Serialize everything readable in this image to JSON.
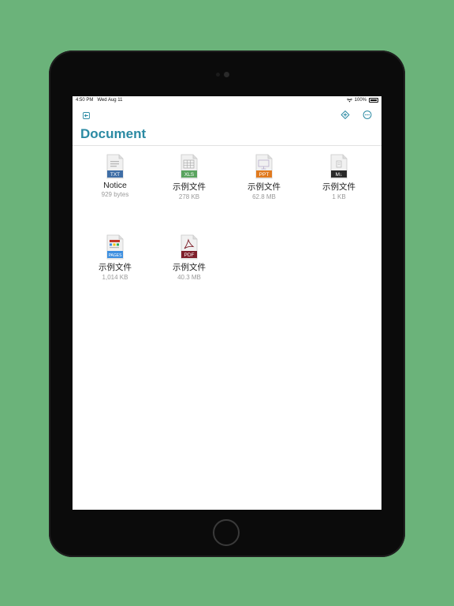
{
  "status_bar": {
    "time": "4:50 PM",
    "date": "Wed Aug 11",
    "battery": "100%"
  },
  "header": {
    "title": "Document"
  },
  "files": [
    {
      "name": "Notice",
      "size": "929 bytes",
      "badge": "TXT",
      "badge_color": "#3f6ea6"
    },
    {
      "name": "示例文件",
      "size": "278 KB",
      "badge": "XLS",
      "badge_color": "#5aa35f"
    },
    {
      "name": "示例文件",
      "size": "62.8 MB",
      "badge": "PPT",
      "badge_color": "#e07a1f"
    },
    {
      "name": "示例文件",
      "size": "1 KB",
      "badge": "M↓",
      "badge_color": "#2a2a2a"
    },
    {
      "name": "示例文件",
      "size": "1,014 KB",
      "badge": "PAGES",
      "badge_color": "#3d8fe0"
    },
    {
      "name": "示例文件",
      "size": "40.3 MB",
      "badge": "PDF",
      "badge_color": "#7e1f2a"
    }
  ],
  "colors": {
    "accent": "#2b8aa3",
    "background": "#6bb37a"
  }
}
